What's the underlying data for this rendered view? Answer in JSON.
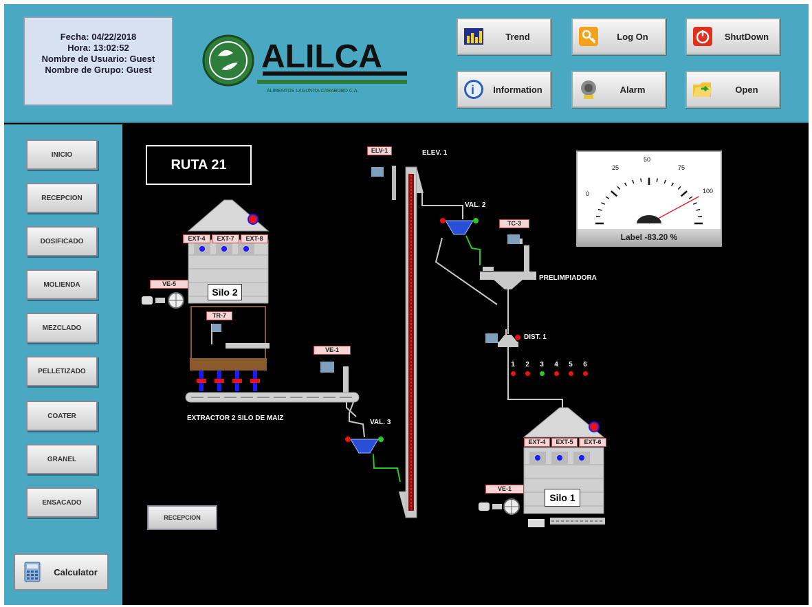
{
  "header": {
    "info_lines": [
      "Fecha: 04/22/2018",
      "Hora: 13:02:52",
      "Nombre de Usuario: Guest",
      "Nombre de Grupo: Guest"
    ],
    "logo": {
      "name": "ALILCA",
      "tagline": "ALIMENTOS LAGUNITA CARABOBO C.A."
    },
    "buttons": {
      "trend": "Trend",
      "logon": "Log On",
      "shutdown": "ShutDown",
      "information": "Information",
      "alarm": "Alarm",
      "open": "Open"
    }
  },
  "sidebar": {
    "items": [
      "INICIO",
      "RECEPCION",
      "DOSIFICADO",
      "MOLIENDA",
      "MEZCLADO",
      "PELLETIZADO",
      "COATER",
      "GRANEL",
      "ENSACADO"
    ],
    "calculator": "Calculator"
  },
  "main": {
    "route_title": "RUTA  21",
    "recepcion_button": "RECEPCION",
    "labels": {
      "elev1": "ELEV. 1",
      "val2": "VAL. 2",
      "val3": "VAL. 3",
      "prelimpiadora": "PRELIMPIADORA",
      "dist1": "DIST. 1",
      "extractor": "EXTRACTOR 2 SILO DE MAIZ"
    },
    "tags": {
      "elv1": "ELV-1",
      "tc3": "TC-3",
      "ve5": "VE-5",
      "tr7": "TR-7",
      "ve1_mid": "VE-1",
      "ve1_silo1": "VE-1"
    },
    "silo2": {
      "name": "Silo 2",
      "extractors": [
        "EXT-4",
        "EXT-7",
        "EXT-8"
      ]
    },
    "silo1": {
      "name": "Silo 1",
      "extractors": [
        "EXT-4",
        "EXT-5",
        "EXT-6"
      ]
    },
    "distributor_outputs": [
      "1",
      "2",
      "3",
      "4",
      "5",
      "6"
    ],
    "distributor_active": [
      false,
      false,
      true,
      false,
      false,
      false
    ],
    "gauge": {
      "ticks": [
        "0",
        "25",
        "50",
        "75",
        "100"
      ],
      "label": "Label -83.20 %",
      "needle_value": 82
    },
    "colors": {
      "active": "#22cc22",
      "inactive": "#ee1111",
      "tag_bg": "#f4d6d6"
    }
  }
}
